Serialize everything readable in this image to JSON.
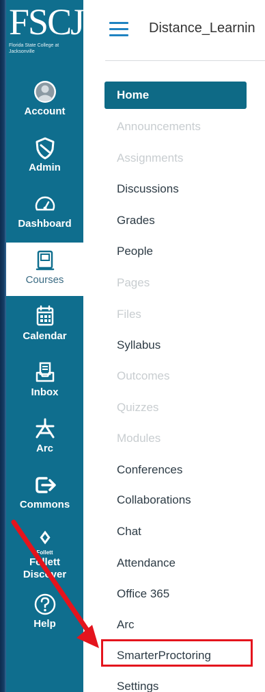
{
  "logo": {
    "mark": "FSCJ",
    "subtitle": "Florida State College at Jacksonville"
  },
  "global_nav": [
    {
      "label": "Account",
      "icon": "account-avatar-icon"
    },
    {
      "label": "Admin",
      "icon": "shield-icon"
    },
    {
      "label": "Dashboard",
      "icon": "dashboard-gauge-icon"
    },
    {
      "label": "Courses",
      "icon": "book-icon",
      "active": true
    },
    {
      "label": "Calendar",
      "icon": "calendar-icon"
    },
    {
      "label": "Inbox",
      "icon": "inbox-icon"
    },
    {
      "label": "Arc",
      "icon": "arc-icon"
    },
    {
      "label": "Commons",
      "icon": "commons-arrow-icon"
    },
    {
      "label": "Follett Discover",
      "icon": "follett-icon",
      "icon_text": "Follett"
    },
    {
      "label": "Help",
      "icon": "help-icon"
    }
  ],
  "header": {
    "breadcrumb": "Distance_Learnin"
  },
  "course_nav": [
    {
      "label": "Home",
      "state": "active"
    },
    {
      "label": "Announcements",
      "state": "disabled"
    },
    {
      "label": "Assignments",
      "state": "disabled"
    },
    {
      "label": "Discussions",
      "state": "enabled"
    },
    {
      "label": "Grades",
      "state": "enabled"
    },
    {
      "label": "People",
      "state": "enabled"
    },
    {
      "label": "Pages",
      "state": "disabled"
    },
    {
      "label": "Files",
      "state": "disabled"
    },
    {
      "label": "Syllabus",
      "state": "enabled"
    },
    {
      "label": "Outcomes",
      "state": "disabled"
    },
    {
      "label": "Quizzes",
      "state": "disabled"
    },
    {
      "label": "Modules",
      "state": "disabled"
    },
    {
      "label": "Conferences",
      "state": "enabled"
    },
    {
      "label": "Collaborations",
      "state": "enabled"
    },
    {
      "label": "Chat",
      "state": "enabled"
    },
    {
      "label": "Attendance",
      "state": "enabled"
    },
    {
      "label": "Office 365",
      "state": "enabled"
    },
    {
      "label": "Arc",
      "state": "enabled"
    },
    {
      "label": "SmarterProctoring",
      "state": "enabled",
      "highlighted": true
    },
    {
      "label": "Settings",
      "state": "enabled"
    }
  ],
  "colors": {
    "global_nav_bg": "#0f6e8e",
    "home_bg": "#0e6a86",
    "annotation_red": "#e4141d",
    "hamburger_blue": "#1f83c1"
  }
}
